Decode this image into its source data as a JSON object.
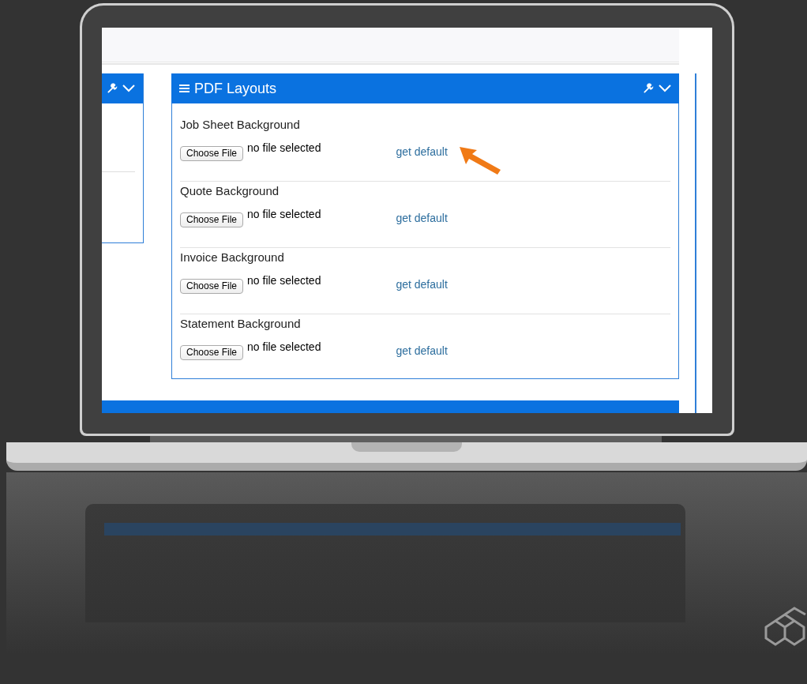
{
  "pdf_panel": {
    "title": "PDF Layouts",
    "rows": [
      {
        "label": "Job Sheet Background",
        "button": "Choose File",
        "status": "no file selected",
        "link": "get default",
        "highlighted": true
      },
      {
        "label": "Quote Background",
        "button": "Choose File",
        "status": "no file selected",
        "link": "get default",
        "highlighted": false
      },
      {
        "label": "Invoice Background",
        "button": "Choose File",
        "status": "no file selected",
        "link": "get default",
        "highlighted": false
      },
      {
        "label": "Statement Background",
        "button": "Choose File",
        "status": "no file selected",
        "link": "get default",
        "highlighted": false
      }
    ]
  }
}
